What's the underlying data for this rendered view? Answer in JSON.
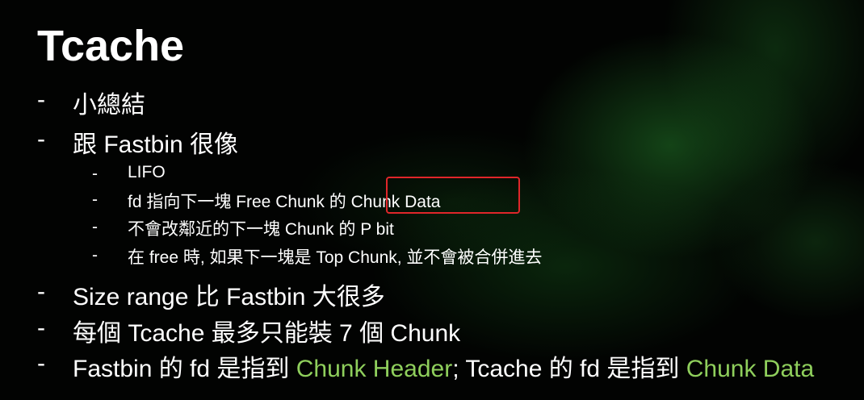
{
  "slide": {
    "title": "Tcache",
    "bullet_marker": "-",
    "items": [
      {
        "text": "小總結"
      },
      {
        "text": "跟 Fastbin 很像"
      },
      {
        "text": "LIFO"
      },
      {
        "text": "fd 指向下一塊 Free Chunk 的 Chunk Data"
      },
      {
        "text": "不會改鄰近的下一塊 Chunk 的 P bit"
      },
      {
        "text": "在 free 時, 如果下一塊是 Top Chunk, 並不會被合併進去"
      },
      {
        "text": "Size range 比 Fastbin 大很多"
      },
      {
        "text": "每個 Tcache 最多只能裝 7 個 Chunk"
      },
      {
        "part1": "Fastbin 的 fd 是指到 ",
        "part2": "Chunk Header",
        "part3": "; Tcache 的 fd 是指到 ",
        "part4": "Chunk Data"
      }
    ],
    "highlight_color": "#8fcf5c",
    "annotation_box_color": "#e0262a"
  }
}
